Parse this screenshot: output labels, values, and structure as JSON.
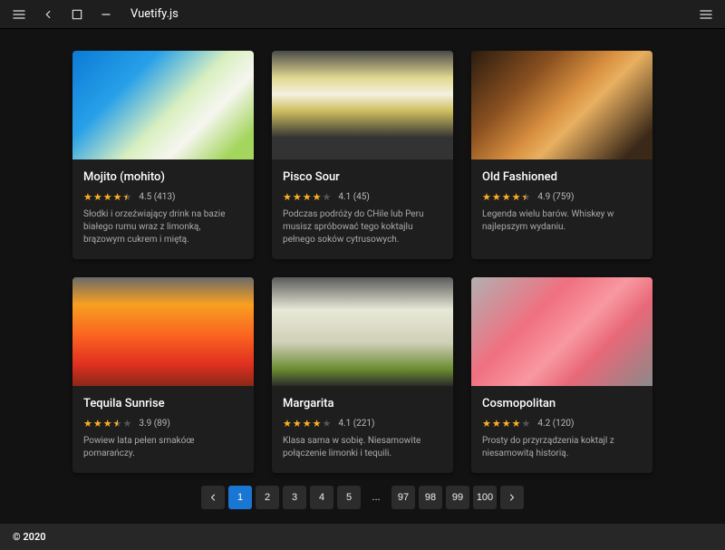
{
  "header": {
    "title": "Vuetify.js"
  },
  "cards": [
    {
      "title": "Mojito (mohito)",
      "rating": 4.5,
      "count": 413,
      "desc": "Słodki i orzeźwiający drink na bazie białego rumu wraz z limonką, brązowym cukrem i miętą.",
      "img": "img-mojito"
    },
    {
      "title": "Pisco Sour",
      "rating": 4.1,
      "count": 45,
      "desc": "Podczas podróży do CHile lub Peru musisz spróbować tego koktajlu pełnego soków cytrusowych.",
      "img": "img-pisco"
    },
    {
      "title": "Old Fashioned",
      "rating": 4.9,
      "count": 759,
      "desc": "Legenda wielu barów. Whiskey w najlepszym wydaniu.",
      "img": "img-old"
    },
    {
      "title": "Tequila Sunrise",
      "rating": 3.9,
      "count": 89,
      "desc": "Powiew lata pełen smakóœ pomarańczy.",
      "img": "img-tequila"
    },
    {
      "title": "Margarita",
      "rating": 4.1,
      "count": 221,
      "desc": "Klasa sama w sobię. Niesamowite połączenie limonki i tequili.",
      "img": "img-margarita"
    },
    {
      "title": "Cosmopolitan",
      "rating": 4.2,
      "count": 120,
      "desc": "Prosty do przyrządzenia koktajl z niesamowitą historią.",
      "img": "img-cosmo"
    }
  ],
  "pagination": {
    "active": 1,
    "pages": [
      "1",
      "2",
      "3",
      "4",
      "5",
      "...",
      "97",
      "98",
      "99",
      "100"
    ]
  },
  "footer": {
    "text": "© 2020"
  }
}
